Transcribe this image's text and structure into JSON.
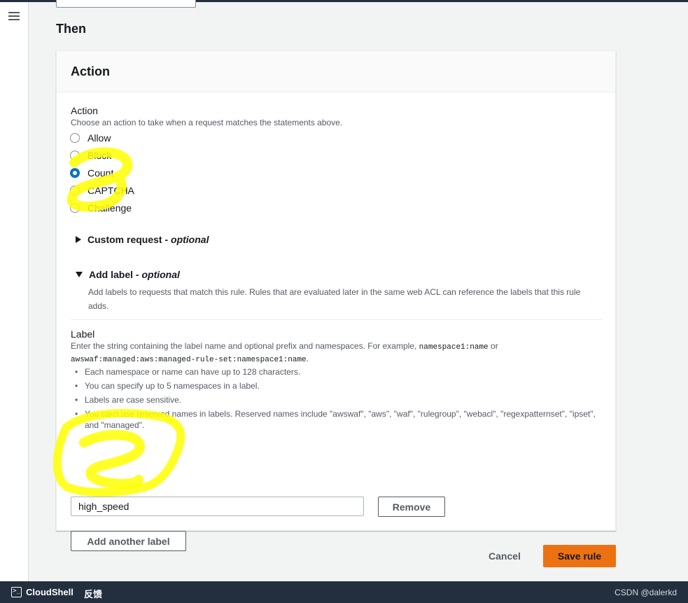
{
  "section_heading": "Then",
  "panel": {
    "title": "Action",
    "action_label": "Action",
    "action_description": "Choose an action to take when a request matches the statements above.",
    "options": [
      {
        "label": "Allow",
        "selected": false
      },
      {
        "label": "Block",
        "selected": false
      },
      {
        "label": "Count",
        "selected": true
      },
      {
        "label": "CAPTCHA",
        "selected": false
      },
      {
        "label": "Challenge",
        "selected": false
      }
    ],
    "custom_request": {
      "title": "Custom request",
      "optional": "optional",
      "expanded": false
    },
    "add_label": {
      "title": "Add label",
      "optional": "optional",
      "expanded": true,
      "description": "Add labels to requests that match this rule. Rules that are evaluated later in the same web ACL can reference the labels that this rule adds."
    },
    "label_field": {
      "label": "Label",
      "desc_prefix": "Enter the string containing the label name and optional prefix and namespaces. For example,",
      "example1": "namespace1:name",
      "or": "or",
      "example2": "awswaf:managed:aws:managed-rule-set:namespace1:name",
      "period": ".",
      "bullets": [
        "Each namespace or name can have up to 128 characters.",
        "You can specify up to 5 namespaces in a label.",
        "Labels are case sensitive.",
        "You can't use reserved names in labels. Reserved names include \"awswaf\", \"aws\", \"waf\", \"rulegroup\", \"webacl\", \"regexpatternset\", \"ipset\", and \"managed\"."
      ],
      "value": "high_speed",
      "remove_label": "Remove",
      "add_another_label": "Add another label"
    }
  },
  "footer": {
    "cancel_label": "Cancel",
    "save_label": "Save rule"
  },
  "bottom_bar": {
    "cloudshell_label": "CloudShell",
    "feedback_label": "反馈",
    "watermark": "CSDN @dalerkd"
  },
  "colors": {
    "primary": "#ec7211",
    "selected_radio": "#0073bb",
    "highlighter": "#ffff00",
    "navbar": "#232f3e"
  }
}
